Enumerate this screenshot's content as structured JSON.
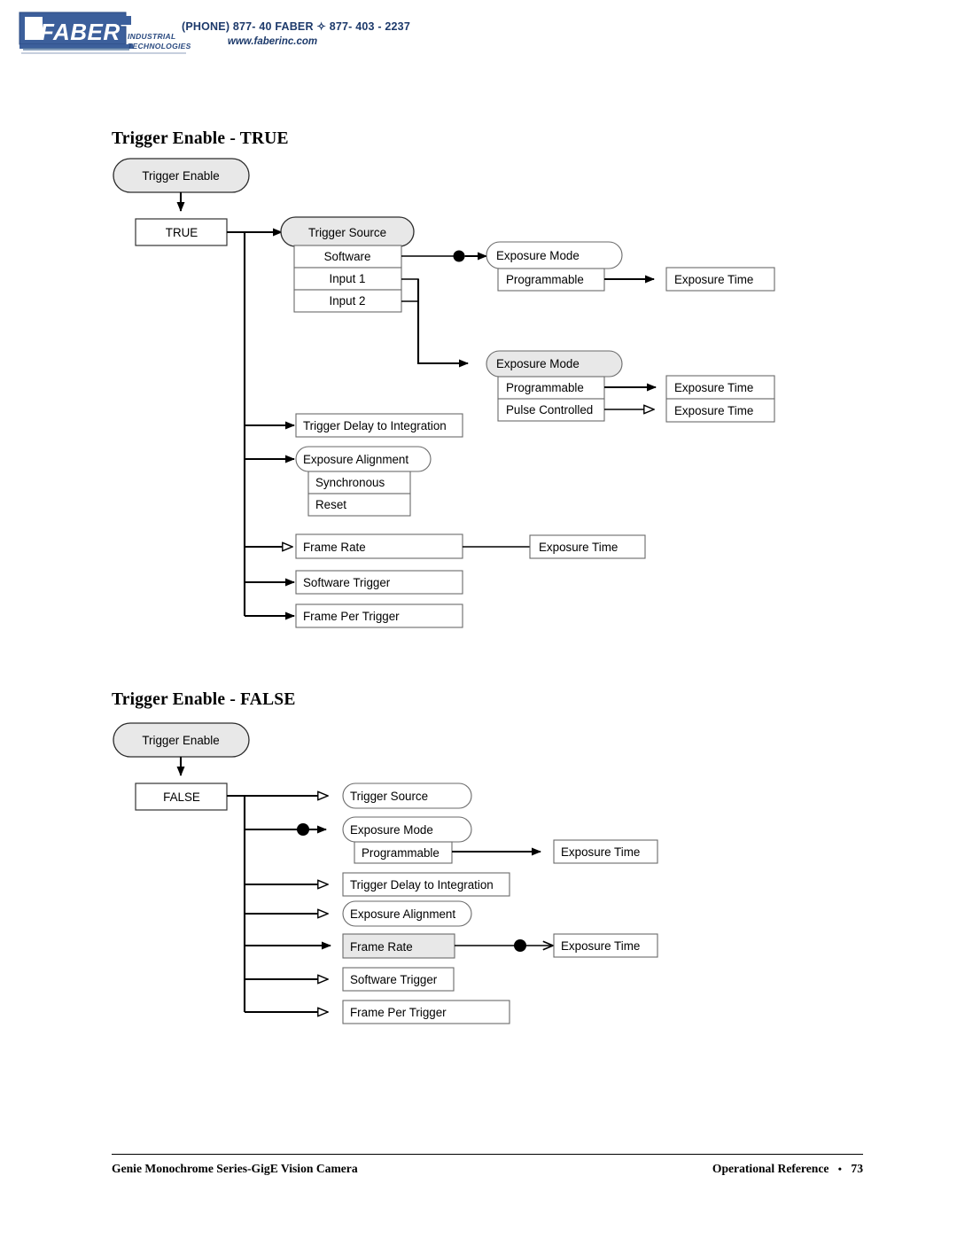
{
  "header": {
    "logo_text": "FABER",
    "logo_subtitle_line1": "INDUSTRIAL",
    "logo_subtitle_line2": "TECHNOLOGIES",
    "phone": "(PHONE) 877- 40 FABER  ✧  877- 403 - 2237",
    "website": "www.faberinc.com",
    "brand_color": "#2a4a80"
  },
  "footer": {
    "left": "Genie Monochrome Series-GigE Vision Camera",
    "right": "Operational Reference",
    "bullet": "•",
    "page_number": "73"
  },
  "colors": {
    "gray_fill": "#e8e8e8",
    "white_fill": "#ffffff",
    "border": "#6a6a6a",
    "border_dark": "#333333",
    "line": "#000000"
  },
  "sections": [
    {
      "id": "true",
      "title": "Trigger Enable - TRUE",
      "root_label": "Trigger Enable",
      "state_label": "TRUE",
      "nodes": [
        {
          "name": "trigger-source",
          "label": "Trigger Source",
          "fill": "gray",
          "shape": "capsule",
          "arrow": "solid"
        },
        {
          "name": "software",
          "label": "Software",
          "fill": "white",
          "shape": "rect-center",
          "arrow": "none"
        },
        {
          "name": "input-1",
          "label": "Input 1",
          "fill": "white",
          "shape": "rect-center",
          "arrow": "none"
        },
        {
          "name": "input-2",
          "label": "Input 2",
          "fill": "white",
          "shape": "rect-center",
          "arrow": "none"
        },
        {
          "name": "exposure-mode-1",
          "label": "Exposure Mode",
          "fill": "white",
          "shape": "capsule",
          "arrow": "solid-dot"
        },
        {
          "name": "programmable-1",
          "label": "Programmable",
          "fill": "white",
          "shape": "rect-left",
          "arrow": "none"
        },
        {
          "name": "exposure-time-1",
          "label": "Exposure Time",
          "fill": "white",
          "shape": "rect-left",
          "arrow": "solid"
        },
        {
          "name": "exposure-mode-2",
          "label": "Exposure Mode",
          "fill": "gray",
          "shape": "capsule",
          "arrow": "solid"
        },
        {
          "name": "programmable-2",
          "label": "Programmable",
          "fill": "white",
          "shape": "rect-left",
          "arrow": "none"
        },
        {
          "name": "pulse-controlled",
          "label": "Pulse Controlled",
          "fill": "white",
          "shape": "rect-left",
          "arrow": "none"
        },
        {
          "name": "exposure-time-2",
          "label": "Exposure Time",
          "fill": "white",
          "shape": "rect-left",
          "arrow": "solid"
        },
        {
          "name": "exposure-time-3",
          "label": "Exposure Time",
          "fill": "white",
          "shape": "rect-left",
          "arrow": "hollow"
        },
        {
          "name": "trigger-delay",
          "label": "Trigger Delay to Integration",
          "fill": "white",
          "shape": "rect-left",
          "arrow": "solid"
        },
        {
          "name": "exposure-align",
          "label": "Exposure Alignment",
          "fill": "white",
          "shape": "capsule",
          "arrow": "solid"
        },
        {
          "name": "synchronous",
          "label": "Synchronous",
          "fill": "white",
          "shape": "rect-left",
          "arrow": "none"
        },
        {
          "name": "reset",
          "label": "Reset",
          "fill": "white",
          "shape": "rect-left",
          "arrow": "none"
        },
        {
          "name": "frame-rate",
          "label": "Frame Rate",
          "fill": "white",
          "shape": "rect-left",
          "arrow": "hollow"
        },
        {
          "name": "exposure-time-4",
          "label": "Exposure Time",
          "fill": "white",
          "shape": "rect-left",
          "arrow": "hollow-back"
        },
        {
          "name": "software-trigger",
          "label": "Software Trigger",
          "fill": "white",
          "shape": "rect-left",
          "arrow": "solid"
        },
        {
          "name": "frame-per-trigger",
          "label": "Frame Per Trigger",
          "fill": "white",
          "shape": "rect-left",
          "arrow": "solid"
        }
      ]
    },
    {
      "id": "false",
      "title": "Trigger Enable - FALSE",
      "root_label": "Trigger Enable",
      "state_label": "FALSE",
      "nodes": [
        {
          "name": "trigger-source",
          "label": "Trigger Source",
          "fill": "white",
          "shape": "capsule",
          "arrow": "hollow"
        },
        {
          "name": "exposure-mode",
          "label": "Exposure Mode",
          "fill": "white",
          "shape": "capsule",
          "arrow": "solid-dot"
        },
        {
          "name": "programmable",
          "label": "Programmable",
          "fill": "white",
          "shape": "rect-left",
          "arrow": "none"
        },
        {
          "name": "exposure-time-1",
          "label": "Exposure Time",
          "fill": "white",
          "shape": "rect-left",
          "arrow": "solid"
        },
        {
          "name": "trigger-delay",
          "label": "Trigger Delay to Integration",
          "fill": "white",
          "shape": "rect-left",
          "arrow": "hollow"
        },
        {
          "name": "exposure-align",
          "label": "Exposure Alignment",
          "fill": "white",
          "shape": "capsule",
          "arrow": "hollow"
        },
        {
          "name": "frame-rate",
          "label": "Frame Rate",
          "fill": "gray",
          "shape": "rect-left",
          "arrow": "solid"
        },
        {
          "name": "exposure-time-2",
          "label": "Exposure Time",
          "fill": "white",
          "shape": "rect-left",
          "arrow": "hollow-back-dot"
        },
        {
          "name": "software-trigger",
          "label": "Software Trigger",
          "fill": "white",
          "shape": "rect-left",
          "arrow": "hollow"
        },
        {
          "name": "frame-per-trigger",
          "label": "Frame Per Trigger",
          "fill": "white",
          "shape": "rect-left",
          "arrow": "hollow"
        }
      ]
    }
  ]
}
